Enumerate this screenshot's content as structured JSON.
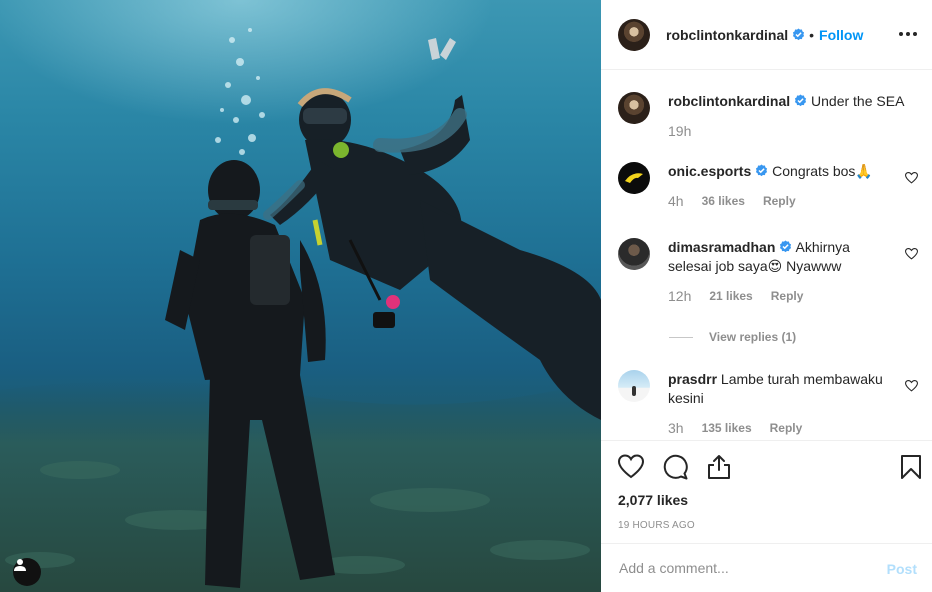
{
  "post": {
    "author": "robclintonkardinal",
    "follow_label": "Follow",
    "dot": "•",
    "photo_alt": "Two scuba divers underwater, one giving a peace sign",
    "user_tag_icon": "person-icon"
  },
  "comments": [
    {
      "username": "robclintonkardinal",
      "verified": true,
      "text": "Under the SEA",
      "time": "19h"
    },
    {
      "username": "onic.esports",
      "verified": true,
      "text": "Congrats bos🙏",
      "time": "4h",
      "likes": "36 likes",
      "reply": "Reply"
    },
    {
      "username": "dimasramadhan",
      "verified": true,
      "text": "Akhirnya selesai job saya😍 Nyawww",
      "time": "12h",
      "likes": "21 likes",
      "reply": "Reply",
      "view_replies": "View replies (1)"
    },
    {
      "username": "prasdrr",
      "verified": false,
      "text": "Lambe turah membawaku kesini",
      "time": "3h",
      "likes": "135 likes",
      "reply": "Reply"
    }
  ],
  "actions": {
    "icons": [
      "heart-icon",
      "comment-icon",
      "share-icon",
      "bookmark-icon"
    ],
    "likes_count": "2,077 likes",
    "timestamp": "19 HOURS AGO"
  },
  "add_comment": {
    "placeholder": "Add a comment...",
    "post_label": "Post"
  },
  "colors": {
    "accent": "#0095f6",
    "text": "#262626",
    "muted": "#8e8e8e",
    "border": "#efefef",
    "post_disabled": "#b2dffc"
  }
}
